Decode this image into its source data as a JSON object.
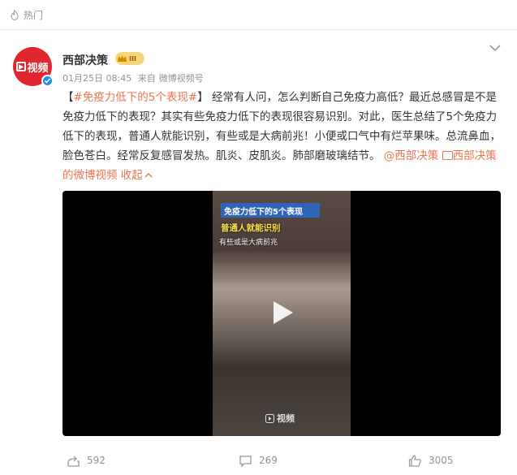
{
  "hot_label": "热门",
  "post": {
    "author": "西部决策",
    "avatar_text": "视频",
    "badge_level": "III",
    "date": "01月25日 08:45",
    "source_prefix": "来自",
    "source": "微博视频号",
    "text": {
      "bracket_open": "【",
      "hashtag": "#免疫力低下的5个表现#",
      "bracket_close": "】",
      "body": "经常有人问，怎么判断自己免疫力高低？最近总感冒是不是免疫力低下的表现？其实有些免疫力低下的表现很容易识别。对此，医生总结了5个免疫力低下的表现，普通人就能识别，有些或是大病前兆！小便或口气中有烂苹果味。总流鼻血，脸色苍白。经常反复感冒发热。肌炎、皮肌炎。肺部磨玻璃结节。",
      "mention": "@西部决策",
      "video_link": "西部决策的微博视频",
      "collapse": "收起"
    },
    "video": {
      "caption_title": "免疫力低下的5个表现",
      "caption_line2": "普通人就能识别",
      "caption_line3": "有些或是大病前兆",
      "watermark": "视频"
    },
    "actions": {
      "reposts": "592",
      "comments": "269",
      "likes": "3005"
    }
  }
}
